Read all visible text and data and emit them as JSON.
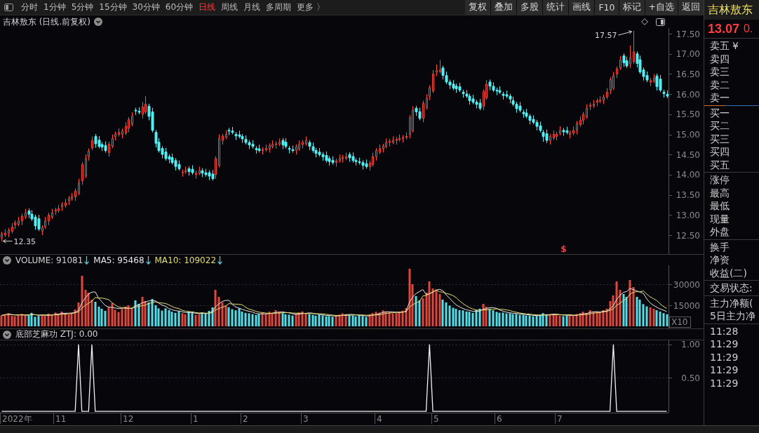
{
  "toolbar": {
    "periods": [
      {
        "label": "分时",
        "selected": false
      },
      {
        "label": "1分钟",
        "selected": false
      },
      {
        "label": "5分钟",
        "selected": false
      },
      {
        "label": "15分钟",
        "selected": false
      },
      {
        "label": "30分钟",
        "selected": false
      },
      {
        "label": "60分钟",
        "selected": false
      },
      {
        "label": "日线",
        "selected": true
      },
      {
        "label": "周线",
        "selected": false
      },
      {
        "label": "月线",
        "selected": false
      },
      {
        "label": "多周期",
        "selected": false
      },
      {
        "label": "更多 〉",
        "selected": false
      }
    ],
    "actions": [
      "复权",
      "叠加",
      "多股",
      "统计",
      "画线",
      "F10",
      "标记",
      "+自选",
      "返回"
    ]
  },
  "chart_header": {
    "title": "吉林敖东 (日线.前复权)"
  },
  "main_chart": {
    "price_axis": [
      "17.50",
      "17.00",
      "16.50",
      "16.00",
      "15.50",
      "15.00",
      "14.50",
      "14.00",
      "13.50",
      "13.00",
      "12.50"
    ],
    "high_label": "17.57",
    "low_label": "12.35",
    "event_marker": "$"
  },
  "volume_panel": {
    "indicators": [
      {
        "reading": ": 91081",
        "falling": true
      },
      {
        "reading": ": 95468",
        "falling": true
      },
      {
        "reading": ": 109022",
        "falling": true
      }
    ],
    "scale_label": "X10",
    "chart_data": {
      "type": "bar",
      "series": [
        {
          "name": "VOLUME",
          "values": [
            7800,
            8600,
            9400,
            7600,
            7200,
            8100,
            8900,
            7700,
            8400,
            9600,
            6800,
            7400,
            8300,
            7500,
            9100,
            8000,
            9800,
            9000,
            10500,
            9200,
            8600,
            9800,
            12000,
            17000,
            36000,
            26000,
            24000,
            19000,
            17500,
            14000,
            12500,
            11000,
            13500,
            16500,
            11800,
            10200,
            12400,
            14200,
            15000,
            13000,
            18500,
            16000,
            21000,
            18000,
            17000,
            19500,
            15000,
            12800,
            11200,
            12800,
            11600,
            10400,
            9600,
            10800,
            9400,
            8600,
            10600,
            9500,
            8200,
            8900,
            9900,
            9000,
            11000,
            13500,
            26000,
            21000,
            17000,
            14800,
            13600,
            12200,
            11400,
            12800,
            10500,
            9600,
            9300,
            8700,
            8100,
            8900,
            9500,
            8600,
            10400,
            9700,
            11500,
            10300,
            9400,
            8600,
            8300,
            7700,
            9100,
            9900,
            10600,
            9400,
            8800,
            8200,
            7600,
            8400,
            7800,
            7200,
            7300,
            6800,
            7700,
            8400,
            9300,
            8700,
            8200,
            7800,
            7100,
            7900,
            7400,
            6700,
            8600,
            9500,
            10300,
            9800,
            11400,
            10600,
            9900,
            9100,
            9600,
            10500,
            11200,
            13000,
            41000,
            30000,
            21500,
            18500,
            20000,
            24000,
            32000,
            27000,
            26000,
            23000,
            19000,
            17000,
            14800,
            13200,
            12500,
            11500,
            11400,
            10600,
            10400,
            9600,
            11500,
            12600,
            16000,
            14000,
            12600,
            11400,
            10300,
            9700,
            9800,
            9200,
            9300,
            8700,
            8800,
            8200,
            8300,
            7700,
            7800,
            7200,
            7700,
            8300,
            9400,
            8600,
            8200,
            8800,
            8300,
            7700,
            7200,
            7800,
            8400,
            7600,
            8700,
            9400,
            10400,
            9600,
            11500,
            10500,
            10300,
            9700,
            11500,
            12600,
            18000,
            22000,
            32000,
            26000,
            23000,
            21000,
            33000,
            28000,
            21000,
            19000,
            15800,
            14200,
            13500,
            12500,
            11500,
            10500,
            9400,
            8600
          ],
          "colors": [
            "#e0463c",
            "#e0463c",
            "#e0463c",
            "#e0463c",
            "#e0463c",
            "#e0463c",
            "#e0463c",
            "#e0463c",
            "#56dde8",
            "#56dde8",
            "#56dde8",
            "#56dde8",
            "#e0463c",
            "#e0463c",
            "#e0463c",
            "#e0463c",
            "#e0463c",
            "#e0463c",
            "#e0463c",
            "#e0463c",
            "#e0463c",
            "#e0463c",
            "#e0463c",
            "#e0463c",
            "#e0463c",
            "#e0463c",
            "#e0463c",
            "#e0463c",
            "#56dde8",
            "#56dde8",
            "#56dde8",
            "#56dde8",
            "#e0463c",
            "#e0463c",
            "#e0463c",
            "#e0463c",
            "#e0463c",
            "#e0463c",
            "#e0463c",
            "#e0463c",
            "#56dde8",
            "#56dde8",
            "#e0463c",
            "#e0463c",
            "#56dde8",
            "#56dde8",
            "#56dde8",
            "#56dde8",
            "#56dde8",
            "#56dde8",
            "#56dde8",
            "#56dde8",
            "#56dde8",
            "#56dde8",
            "#e0463c",
            "#e0463c",
            "#56dde8",
            "#56dde8",
            "#e0463c",
            "#e0463c",
            "#56dde8",
            "#56dde8",
            "#56dde8",
            "#56dde8",
            "#e0463c",
            "#e0463c",
            "#e0463c",
            "#e0463c",
            "#56dde8",
            "#56dde8",
            "#56dde8",
            "#56dde8",
            "#56dde8",
            "#56dde8",
            "#56dde8",
            "#56dde8",
            "#56dde8",
            "#56dde8",
            "#e0463c",
            "#e0463c",
            "#e0463c",
            "#e0463c",
            "#e0463c",
            "#e0463c",
            "#56dde8",
            "#56dde8",
            "#56dde8",
            "#56dde8",
            "#e0463c",
            "#e0463c",
            "#e0463c",
            "#e0463c",
            "#56dde8",
            "#56dde8",
            "#56dde8",
            "#56dde8",
            "#56dde8",
            "#56dde8",
            "#56dde8",
            "#56dde8",
            "#e0463c",
            "#e0463c",
            "#e0463c",
            "#e0463c",
            "#56dde8",
            "#56dde8",
            "#56dde8",
            "#56dde8",
            "#56dde8",
            "#56dde8",
            "#e0463c",
            "#e0463c",
            "#e0463c",
            "#e0463c",
            "#e0463c",
            "#e0463c",
            "#e0463c",
            "#e0463c",
            "#e0463c",
            "#e0463c",
            "#e0463c",
            "#e0463c",
            "#e0463c",
            "#e0463c",
            "#56dde8",
            "#56dde8",
            "#e0463c",
            "#e0463c",
            "#e0463c",
            "#e0463c",
            "#e0463c",
            "#e0463c",
            "#56dde8",
            "#56dde8",
            "#56dde8",
            "#56dde8",
            "#56dde8",
            "#56dde8",
            "#56dde8",
            "#56dde8",
            "#56dde8",
            "#56dde8",
            "#56dde8",
            "#56dde8",
            "#e0463c",
            "#e0463c",
            "#56dde8",
            "#56dde8",
            "#56dde8",
            "#56dde8",
            "#56dde8",
            "#56dde8",
            "#56dde8",
            "#56dde8",
            "#56dde8",
            "#56dde8",
            "#56dde8",
            "#56dde8",
            "#56dde8",
            "#56dde8",
            "#56dde8",
            "#56dde8",
            "#56dde8",
            "#56dde8",
            "#e0463c",
            "#e0463c",
            "#e0463c",
            "#e0463c",
            "#56dde8",
            "#56dde8",
            "#e0463c",
            "#e0463c",
            "#e0463c",
            "#e0463c",
            "#e0463c",
            "#e0463c",
            "#e0463c",
            "#e0463c",
            "#e0463c",
            "#e0463c",
            "#e0463c",
            "#e0463c",
            "#e0463c",
            "#e0463c",
            "#e0463c",
            "#e0463c",
            "#56dde8",
            "#56dde8",
            "#e0463c",
            "#e0463c",
            "#56dde8",
            "#56dde8",
            "#56dde8",
            "#56dde8",
            "#e0463c",
            "#e0463c",
            "#56dde8",
            "#56dde8",
            "#56dde8",
            "#56dde8"
          ]
        },
        {
          "name": "MA5",
          "type": "line",
          "color": "#e8e8e8",
          "values": [
            7800,
            8200,
            8600,
            8400,
            8100,
            8200,
            8200,
            7900,
            8100,
            8500,
            8300,
            8000,
            8100,
            7900,
            7800,
            8100,
            8500,
            8700,
            9300,
            9300,
            9400,
            9400,
            10000,
            11300,
            16700,
            20200,
            23000,
            24400,
            24500,
            20100,
            17400,
            14800,
            13700,
            13500,
            13100,
            12600,
            12900,
            13000,
            12700,
            13000,
            14600,
            15300,
            16700,
            17300,
            18100,
            18300,
            18100,
            16500,
            15100,
            14300,
            12700,
            11800,
            11100,
            11000,
            10400,
            9800,
            9800,
            9800,
            9300,
            9200,
            9400,
            9100,
            9400,
            10500,
            13900,
            16100,
            17700,
            18500,
            18500,
            15700,
            13800,
            13000,
            12100,
            11300,
            10700,
            10200,
            9200,
            8900,
            8900,
            8800,
            9100,
            9400,
            9900,
            10100,
            10300,
            9900,
            9600,
            8900,
            8600,
            8700,
            9100,
            9300,
            9600,
            9400,
            8900,
            8500,
            8200,
            7800,
            7700,
            7500,
            7400,
            7500,
            7900,
            8200,
            8500,
            8500,
            8200,
            7900,
            7700,
            7400,
            7500,
            8000,
            8500,
            9000,
            9900,
            10300,
            10400,
            10200,
            10100,
            9900,
            10100,
            10700,
            17100,
            21100,
            23300,
            24800,
            26200,
            22800,
            23200,
            24300,
            25800,
            26400,
            25400,
            22400,
            20000,
            17400,
            15300,
            13800,
            12700,
            11800,
            11300,
            10700,
            10700,
            10900,
            12000,
            12700,
            13300,
            13300,
            12900,
            11600,
            10800,
            10100,
            9700,
            9300,
            9200,
            8800,
            8700,
            8300,
            8200,
            7800,
            7700,
            7700,
            8100,
            8200,
            8400,
            8700,
            8700,
            8300,
            8000,
            8000,
            7900,
            7700,
            7900,
            8400,
            8900,
            9100,
            9900,
            10300,
            10500,
            10300,
            10700,
            10900,
            12400,
            14800,
            19200,
            22100,
            24200,
            24800,
            27000,
            26200,
            25200,
            24400,
            23400,
            19600,
            16700,
            15000,
            13500,
            12400,
            11500,
            10500
          ]
        },
        {
          "name": "MA10",
          "type": "line",
          "color": "#e6df72",
          "values": [
            7800,
            8200,
            8600,
            8400,
            8100,
            8100,
            8200,
            8200,
            8200,
            8400,
            8300,
            7900,
            8100,
            8200,
            8100,
            8000,
            8300,
            8300,
            8600,
            8700,
            9000,
            9100,
            9700,
            10300,
            13100,
            14800,
            16500,
            17900,
            20600,
            20100,
            20200,
            19600,
            19100,
            16800,
            15200,
            13700,
            13300,
            13300,
            12900,
            12800,
            13800,
            14200,
            14700,
            15100,
            16400,
            16800,
            17400,
            16900,
            16600,
            16300,
            15400,
            14100,
            13100,
            12700,
            11500,
            10800,
            10500,
            10400,
            9800,
            9500,
            9600,
            9400,
            9300,
            9800,
            11700,
            12600,
            13600,
            14500,
            16200,
            15900,
            15800,
            15700,
            15300,
            13500,
            12300,
            11600,
            10700,
            10100,
            9800,
            9500,
            9200,
            9200,
            9400,
            9400,
            9700,
            9700,
            9800,
            9500,
            9400,
            9300,
            9400,
            9100,
            9100,
            9100,
            9000,
            8900,
            8900,
            8600,
            8300,
            8000,
            7800,
            7700,
            7800,
            7800,
            7900,
            8000,
            8100,
            8100,
            8100,
            7900,
            7900,
            8000,
            8100,
            8200,
            8700,
            9200,
            9500,
            9600,
            10000,
            10100,
            10200,
            10400,
            13600,
            15500,
            16700,
            17700,
            21600,
            22000,
            23300,
            24600,
            26000,
            24600,
            24300,
            23400,
            22900,
            21900,
            20400,
            18100,
            16300,
            14600,
            13300,
            12300,
            11700,
            11400,
            11700,
            11700,
            12000,
            12100,
            12400,
            12200,
            12100,
            11700,
            11300,
            10500,
            10000,
            9500,
            9200,
            8800,
            8700,
            8300,
            8200,
            8000,
            8100,
            8000,
            8100,
            8200,
            8400,
            8300,
            8200,
            8300,
            8300,
            8000,
            8000,
            8200,
            8400,
            8400,
            8900,
            9300,
            9700,
            9700,
            10300,
            10600,
            11400,
            12500,
            15000,
            16500,
            18300,
            19800,
            23100,
            24200,
            24700,
            24600,
            25200,
            22900,
            21000,
            19700,
            18400,
            16000,
            14100,
            12800
          ]
        }
      ],
      "ylim": [
        -1500,
        43500
      ],
      "yticks": [
        {
          "value": 15000,
          "label": "15000"
        },
        {
          "value": 30000,
          "label": "30000"
        }
      ]
    }
  },
  "indicator_panel": {
    "title": "底部芝麻功 ZTJ: 0.00",
    "chart_data": {
      "type": "line",
      "values": [
        0,
        0,
        0,
        0,
        0,
        0,
        0,
        0,
        0,
        0,
        0,
        0,
        0,
        0,
        0,
        0,
        0,
        0,
        0,
        0,
        0,
        0,
        0,
        1,
        0,
        0,
        0,
        1,
        0,
        0,
        0,
        0,
        0,
        0,
        0,
        0,
        0,
        0,
        0,
        0,
        0,
        0,
        0,
        0,
        0,
        0,
        0,
        0,
        0,
        0,
        0,
        0,
        0,
        0,
        0,
        0,
        0,
        0,
        0,
        0,
        0,
        0,
        0,
        0,
        0,
        0,
        0,
        0,
        0,
        0,
        0,
        0,
        0,
        0,
        0,
        0,
        0,
        0,
        0,
        0,
        0,
        0,
        0,
        0,
        0,
        0,
        0,
        0,
        0,
        0,
        0,
        0,
        0,
        0,
        0,
        0,
        0,
        0,
        0,
        0,
        0,
        0,
        0,
        0,
        0,
        0,
        0,
        0,
        0,
        0,
        0,
        0,
        0,
        0,
        0,
        0,
        0,
        0,
        0,
        0,
        0,
        0,
        0,
        0,
        0,
        0,
        0,
        0,
        1,
        0,
        0,
        0,
        0,
        0,
        0,
        0,
        0,
        0,
        0,
        0,
        0,
        0,
        0,
        0,
        0,
        0,
        0,
        0,
        0,
        0,
        0,
        0,
        0,
        0,
        0,
        0,
        0,
        0,
        0,
        0,
        0,
        0,
        0,
        0,
        0,
        0,
        0,
        0,
        0,
        0,
        0,
        0,
        0,
        0,
        0,
        0,
        0,
        0,
        0,
        0,
        0,
        0,
        0,
        1,
        0,
        0,
        0,
        0,
        0,
        0,
        0,
        0,
        0,
        0,
        0,
        0,
        0,
        0,
        0,
        0
      ],
      "ylim": [
        -0.02,
        1.06
      ],
      "yticks": [
        {
          "value": 0.5,
          "label": "0.50"
        },
        {
          "value": 1,
          "label": "1.00"
        }
      ]
    }
  },
  "time_axis": {
    "labels": [
      "2022年",
      "11",
      "12",
      "1",
      "2",
      "3",
      "4",
      "5",
      "6",
      "7"
    ]
  },
  "quote_panel": {
    "stock_name": "吉林敖东",
    "price": "13.07",
    "change": "0.",
    "sell_levels": [
      {
        "label": "卖五",
        "suffix": "¥"
      },
      {
        "label": "卖四"
      },
      {
        "label": "卖三"
      },
      {
        "label": "卖二"
      },
      {
        "label": "卖一"
      }
    ],
    "buy_levels": [
      "买一",
      "买二",
      "买三",
      "买四",
      "买五"
    ],
    "stats": [
      "涨停",
      "最高",
      "最低",
      "现量",
      "外盘"
    ],
    "fundamentals": [
      "换手",
      "净资",
      "收益(二)"
    ],
    "trade_status": "交易状态:",
    "capital_flow": [
      "主力净额(",
      "5日主力净"
    ],
    "trade_times": [
      "11:28",
      "11:29",
      "11:29",
      "11:29",
      "11:29"
    ]
  }
}
